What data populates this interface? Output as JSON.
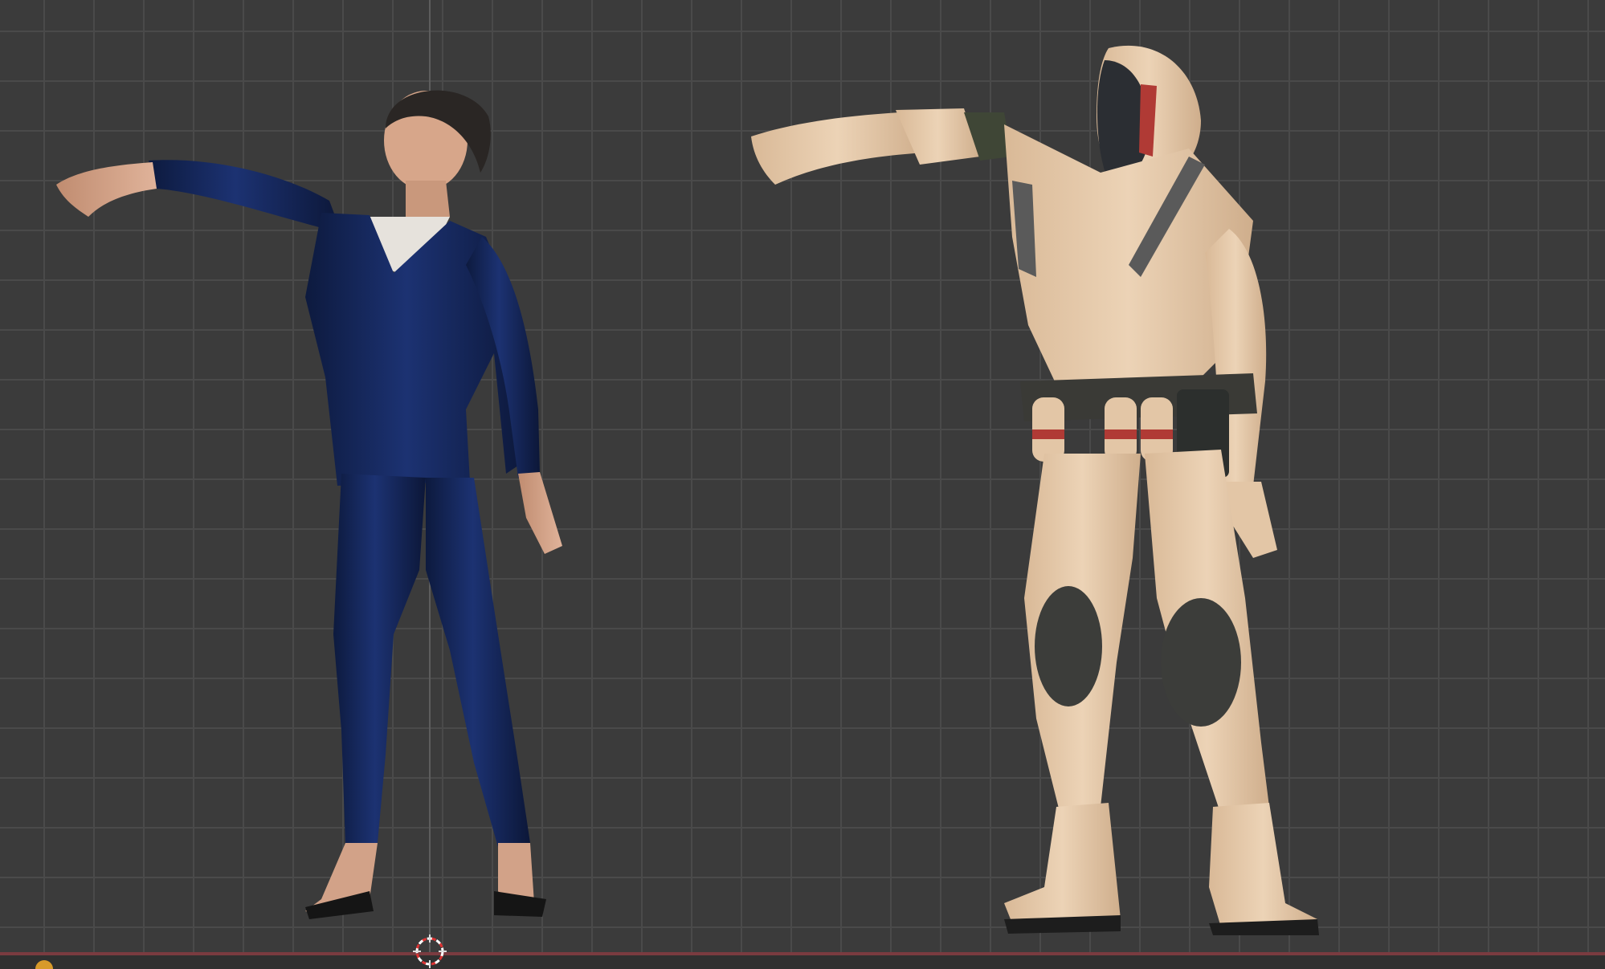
{
  "viewport": {
    "grid_visible": true,
    "background_color": "#3b3b3b",
    "grid_color": "#4a4a4a",
    "x_axis_color": "#7a3b40"
  },
  "objects": [
    {
      "name": "woman-in-blue-suit",
      "colors": {
        "suit": "#12224f",
        "shirt": "#e6e2dc",
        "skin": "#d9a88a",
        "hair": "#2a2624",
        "shoes": "#151515"
      }
    },
    {
      "name": "armored-soldier",
      "colors": {
        "armor": "#e3c6a6",
        "undersuit": "#3f4636",
        "visor": "#2b2e33",
        "accent": "#b03a35"
      }
    }
  ],
  "icons": {
    "cursor": "3d-cursor-icon",
    "origin": "origin-marker-icon"
  }
}
